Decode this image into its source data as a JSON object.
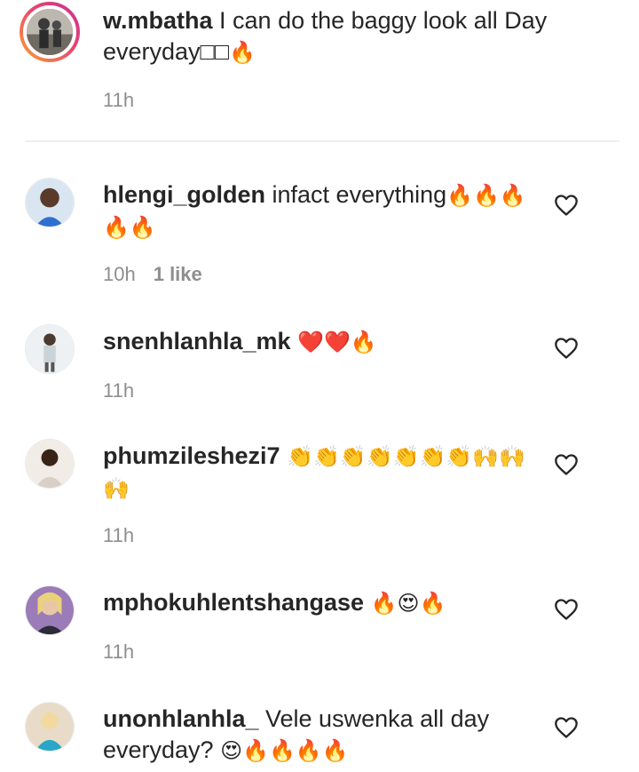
{
  "comments": [
    {
      "user": "w.mbatha",
      "text": " I can do the baggy look all Day everyday□□",
      "emoji": "🔥",
      "time": "11h",
      "likes": "",
      "avatar_color": "#3a3a3a"
    },
    {
      "user": "hlengi_golden",
      "text": " infact everything",
      "emoji": "🔥🔥🔥🔥🔥",
      "time": "10h",
      "likes": "1 like",
      "avatar_color": "#2f6fd0"
    },
    {
      "user": "snenhlanhla_mk",
      "text": " ",
      "emoji": "❤️❤️🔥",
      "time": "11h",
      "likes": "",
      "avatar_color": "#c9d3d8"
    },
    {
      "user": "phumzileshezi7",
      "text": " ",
      "emoji": "👏👏👏👏👏👏👏🙌🙌🙌",
      "time": "11h",
      "likes": "",
      "avatar_color": "#d8cfc6"
    },
    {
      "user": "mphokuhlentshangase",
      "text": " ",
      "emoji": "🔥😍🔥",
      "time": "11h",
      "likes": "",
      "avatar_color": "#6b4a8a"
    },
    {
      "user": "unonhlanhla_",
      "text": " Vele uswenka all day everyday? ",
      "emoji": "😍🔥🔥🔥🔥",
      "time": "",
      "likes": "",
      "avatar_color": "#2aa7c8"
    }
  ],
  "colors": {
    "text": "#262626",
    "muted": "#8e8e8e",
    "divider": "#efefef"
  },
  "icons": {
    "like": "heart-outline-icon"
  }
}
